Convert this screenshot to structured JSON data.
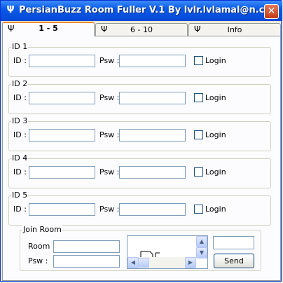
{
  "window": {
    "title": "PersianBuzz Room Fuller V.1 By lvlr.lvlamal@n.c",
    "title_icon": "antenna-icon",
    "close_symbol": "✕"
  },
  "tabs": [
    {
      "label": "1 - 5",
      "icon": "antenna-icon",
      "selected": true
    },
    {
      "label": "6 - 10",
      "icon": "antenna-icon",
      "selected": false
    },
    {
      "label": "Info",
      "icon": "antenna-icon",
      "selected": false
    }
  ],
  "accounts": [
    {
      "title": "ID 1",
      "id_label": "ID :",
      "id_value": "",
      "psw_label": "Psw :",
      "psw_value": "",
      "login_label": "Login",
      "login_checked": false
    },
    {
      "title": "ID 2",
      "id_label": "ID :",
      "id_value": "",
      "psw_label": "Psw :",
      "psw_value": "",
      "login_label": "Login",
      "login_checked": false
    },
    {
      "title": "ID 3",
      "id_label": "ID :",
      "id_value": "",
      "psw_label": "Psw :",
      "psw_value": "",
      "login_label": "Login",
      "login_checked": false
    },
    {
      "title": "ID 4",
      "id_label": "ID :",
      "id_value": "",
      "psw_label": "Psw :",
      "psw_value": "",
      "login_label": "Login",
      "login_checked": false
    },
    {
      "title": "ID 5",
      "id_label": "ID :",
      "id_value": "",
      "psw_label": "Psw :",
      "psw_value": "",
      "login_label": "Login",
      "login_checked": false
    }
  ],
  "join_room": {
    "title": "Join Room",
    "room_label": "Room :",
    "room_value": "",
    "psw_label": "Psw :",
    "psw_value": "",
    "message_value": "",
    "send_label": "Send"
  },
  "colors": {
    "titlebar": "#0a5ae8",
    "window_bg": "#ece9d8",
    "panel_bg": "#fcfcfe",
    "active_tab_accent": "#e68b2c",
    "close_button": "#c23a12"
  }
}
